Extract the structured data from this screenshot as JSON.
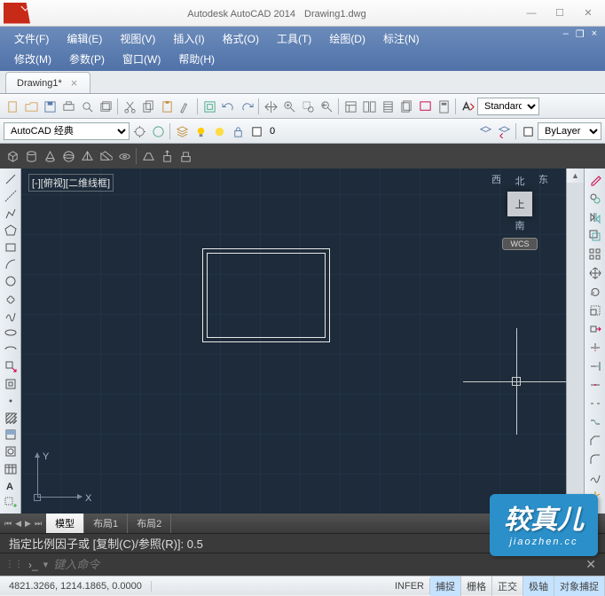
{
  "title": {
    "app": "Autodesk AutoCAD 2014",
    "doc": "Drawing1.dwg"
  },
  "menus": {
    "row1": [
      "文件(F)",
      "编辑(E)",
      "视图(V)",
      "插入(I)",
      "格式(O)",
      "工具(T)",
      "绘图(D)",
      "标注(N)"
    ],
    "row2": [
      "修改(M)",
      "参数(P)",
      "窗口(W)",
      "帮助(H)"
    ]
  },
  "tab": {
    "label": "Drawing1*"
  },
  "workspace": {
    "combo": "AutoCAD 经典",
    "style": "Standard",
    "layer": "ByLayer",
    "layer_zero": "0"
  },
  "viewport": {
    "label": "[-][俯视][二维线框]",
    "wcs": "WCS",
    "vc_top": "北",
    "vc_w": "西",
    "vc_e": "东",
    "vc_s": "南",
    "vc_face": "上",
    "axis_x": "X",
    "axis_y": "Y"
  },
  "layout": {
    "tabs": [
      "模型",
      "布局1",
      "布局2"
    ]
  },
  "cmd": {
    "history": "指定比例因子或 [复制(C)/参照(R)]: 0.5",
    "placeholder": "键入命令"
  },
  "status": {
    "coords": "4821.3266, 1214.1865, 0.0000",
    "buttons": [
      "INFER",
      "捕捉",
      "栅格",
      "正交",
      "极轴",
      "对象捕捉"
    ]
  },
  "watermark": {
    "big": "较真儿",
    "small": "jiaozhen.cc"
  },
  "chart_data": {
    "type": "cad_drawing",
    "objects": [
      {
        "shape": "rectangle",
        "note": "double-outline rectangle in model space"
      }
    ]
  }
}
